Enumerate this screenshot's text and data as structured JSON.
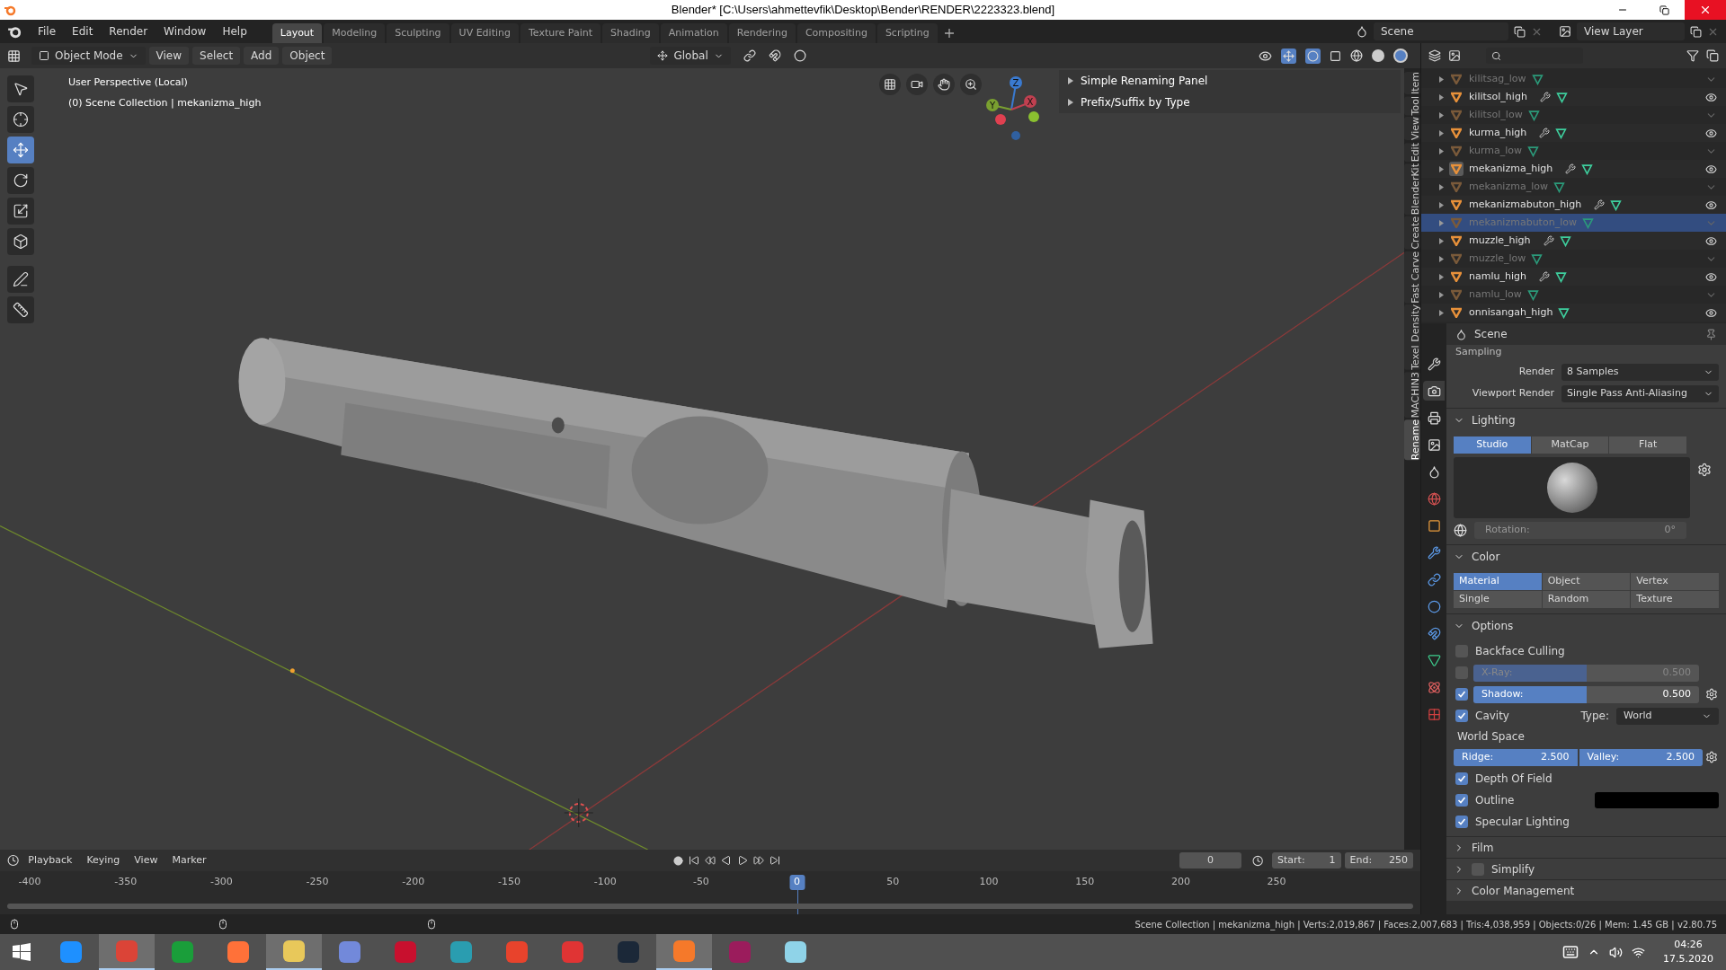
{
  "window": {
    "title": "Blender* [C:\\Users\\ahmettevfik\\Desktop\\Bender\\RENDER\\2223323.blend]"
  },
  "menu": [
    "File",
    "Edit",
    "Render",
    "Window",
    "Help"
  ],
  "workspaces": [
    {
      "label": "Layout",
      "selected": true
    },
    {
      "label": "Modeling",
      "selected": false
    },
    {
      "label": "Sculpting",
      "selected": false
    },
    {
      "label": "UV Editing",
      "selected": false
    },
    {
      "label": "Texture Paint",
      "selected": false
    },
    {
      "label": "Shading",
      "selected": false
    },
    {
      "label": "Animation",
      "selected": false
    },
    {
      "label": "Rendering",
      "selected": false
    },
    {
      "label": "Compositing",
      "selected": false
    },
    {
      "label": "Scripting",
      "selected": false
    }
  ],
  "scene_field": "Scene",
  "view_layer_field": "View Layer",
  "viewport_header": {
    "mode": "Object Mode",
    "menus": [
      "View",
      "Select",
      "Add",
      "Object"
    ],
    "orientation": "Global"
  },
  "toolbar": [
    {
      "kind": "select",
      "selected": false
    },
    {
      "kind": "cursor",
      "selected": false
    },
    {
      "kind": "move",
      "selected": true
    },
    {
      "kind": "rotate",
      "selected": false
    },
    {
      "kind": "scale",
      "selected": false
    },
    {
      "kind": "transform",
      "selected": false
    },
    {
      "kind": "annotate",
      "selected": false
    },
    {
      "kind": "measure",
      "selected": false
    }
  ],
  "viewport": {
    "info": [
      "User Perspective (Local)",
      "(0) Scene Collection | mekanizma_high"
    ],
    "gizmo": {
      "z": "Z",
      "y": "Y",
      "x": "X"
    },
    "panels": [
      "Simple Renaming Panel",
      "Prefix/Suffix by Type"
    ]
  },
  "side_tabs": [
    {
      "label": "Item",
      "selected": false
    },
    {
      "label": "Tool",
      "selected": false
    },
    {
      "label": "View",
      "selected": false
    },
    {
      "label": "Edit",
      "selected": false
    },
    {
      "label": "BlenderKit",
      "selected": false
    },
    {
      "label": "Create",
      "selected": false
    },
    {
      "label": "Fast Carve",
      "selected": false
    },
    {
      "label": "Texel Density",
      "selected": false
    },
    {
      "label": "MACHIN3",
      "selected": false
    },
    {
      "label": "Rename",
      "selected": true
    }
  ],
  "outliner": [
    {
      "name": "kilitsag_low",
      "visible": false,
      "modifiers": false,
      "selected": false,
      "active": false
    },
    {
      "name": "kilitsol_high",
      "visible": true,
      "modifiers": true,
      "selected": false,
      "active": false
    },
    {
      "name": "kilitsol_low",
      "visible": false,
      "modifiers": false,
      "selected": false,
      "active": false
    },
    {
      "name": "kurma_high",
      "visible": true,
      "modifiers": true,
      "selected": false,
      "active": false
    },
    {
      "name": "kurma_low",
      "visible": false,
      "modifiers": false,
      "selected": false,
      "active": false
    },
    {
      "name": "mekanizma_high",
      "visible": true,
      "modifiers": true,
      "selected": false,
      "active": true
    },
    {
      "name": "mekanizma_low",
      "visible": false,
      "modifiers": false,
      "selected": false,
      "active": false
    },
    {
      "name": "mekanizmabuton_high",
      "visible": true,
      "modifiers": true,
      "selected": false,
      "active": false
    },
    {
      "name": "mekanizmabuton_low",
      "visible": false,
      "modifiers": false,
      "selected": true,
      "active": false
    },
    {
      "name": "muzzle_high",
      "visible": true,
      "modifiers": true,
      "selected": false,
      "active": false
    },
    {
      "name": "muzzle_low",
      "visible": false,
      "modifiers": false,
      "selected": false,
      "active": false
    },
    {
      "name": "namlu_high",
      "visible": true,
      "modifiers": true,
      "selected": false,
      "active": false
    },
    {
      "name": "namlu_low",
      "visible": false,
      "modifiers": false,
      "selected": false,
      "active": false
    },
    {
      "name": "onnisangah_high",
      "visible": true,
      "modifiers": false,
      "selected": false,
      "active": false
    }
  ],
  "properties": {
    "context": "Scene",
    "tabs": [
      {
        "kind": "tool",
        "selected": false
      },
      {
        "kind": "render",
        "selected": true
      },
      {
        "kind": "output",
        "selected": false
      },
      {
        "kind": "view_layer",
        "selected": false
      },
      {
        "kind": "scene",
        "selected": false
      },
      {
        "kind": "world",
        "selected": false
      },
      {
        "kind": "object",
        "selected": false
      },
      {
        "kind": "modifiers",
        "selected": false
      },
      {
        "kind": "particles",
        "selected": false
      },
      {
        "kind": "physics",
        "selected": false
      },
      {
        "kind": "constraints",
        "selected": false
      },
      {
        "kind": "data",
        "selected": false
      },
      {
        "kind": "material",
        "selected": false
      },
      {
        "kind": "texture",
        "selected": false
      }
    ],
    "sampling": {
      "title": "Sampling",
      "rows": [
        {
          "label": "Render",
          "value": "8 Samples"
        },
        {
          "label": "Viewport Render",
          "value": "Single Pass Anti-Aliasing"
        }
      ]
    },
    "lighting": {
      "title": "Lighting",
      "expanded": true,
      "modes": [
        {
          "label": "Studio",
          "selected": true
        },
        {
          "label": "MatCap",
          "selected": false
        },
        {
          "label": "Flat",
          "selected": false
        }
      ],
      "rotation_label": "Rotation:",
      "rotation": "0°"
    },
    "color": {
      "title": "Color",
      "expanded": true,
      "options": [
        {
          "label": "Material",
          "selected": true
        },
        {
          "label": "Object",
          "selected": false
        },
        {
          "label": "Vertex",
          "selected": false
        },
        {
          "label": "Single",
          "selected": false
        },
        {
          "label": "Random",
          "selected": false
        },
        {
          "label": "Texture",
          "selected": false
        }
      ]
    },
    "options": {
      "title": "Options",
      "expanded": true,
      "items": [
        {
          "kind": "checkbox",
          "label": "Backface Culling",
          "checked": false
        },
        {
          "kind": "slider",
          "label": "X-Ray:",
          "value": "0.500",
          "level": 0.5,
          "checked": false
        },
        {
          "kind": "slider",
          "label": "Shadow:",
          "value": "0.500",
          "level": 0.5,
          "checked": true
        },
        {
          "kind": "cavity",
          "label": "Cavity",
          "checked": true,
          "type_label": "Type:",
          "type": "World"
        },
        {
          "kind": "label",
          "label": "World Space"
        },
        {
          "kind": "pair",
          "sliders": [
            {
              "label": "Ridge:",
              "value": "2.500",
              "level": 1
            },
            {
              "label": "Valley:",
              "value": "2.500",
              "level": 1
            }
          ]
        },
        {
          "kind": "checkbox",
          "label": "Depth Of Field",
          "checked": true
        },
        {
          "kind": "swatch",
          "label": "Outline",
          "checked": true,
          "color": "#000000"
        },
        {
          "kind": "checkbox",
          "label": "Specular Lighting",
          "checked": true
        }
      ]
    },
    "collapsed": [
      {
        "kind": "panel",
        "title": "Film"
      },
      {
        "kind": "checkbox_panel",
        "title": "Simplify",
        "checked": false
      },
      {
        "kind": "panel",
        "title": "Color Management"
      }
    ]
  },
  "timeline": {
    "menus": [
      "Playback",
      "Keying",
      "View",
      "Marker"
    ],
    "frame": "0",
    "start_label": "Start:",
    "start": "1",
    "end_label": "End:",
    "end": "250",
    "ticks": [
      {
        "label": "-400",
        "selected": false
      },
      {
        "label": "-350",
        "selected": false
      },
      {
        "label": "-300",
        "selected": false
      },
      {
        "label": "-250",
        "selected": false
      },
      {
        "label": "-200",
        "selected": false
      },
      {
        "label": "-150",
        "selected": false
      },
      {
        "label": "-100",
        "selected": false
      },
      {
        "label": "-50",
        "selected": false
      },
      {
        "label": "0",
        "selected": true
      },
      {
        "label": "50",
        "selected": false
      },
      {
        "label": "100",
        "selected": false
      },
      {
        "label": "150",
        "selected": false
      },
      {
        "label": "200",
        "selected": false
      },
      {
        "label": "250",
        "selected": false
      }
    ]
  },
  "status": "Scene Collection | mekanizma_high | Verts:2,019,867 | Faces:2,007,683 | Tris:4,038,959 | Objects:0/26 | Mem: 1.45 GB | v2.80.75",
  "taskbar": {
    "apps": [
      {
        "color": "#1e90ff",
        "active": false
      },
      {
        "color": "#db4437",
        "active": true
      },
      {
        "color": "#1a9e3a",
        "active": false
      },
      {
        "color": "#ff7139",
        "active": false
      },
      {
        "color": "#e8c85a",
        "active": true
      },
      {
        "color": "#7289da",
        "active": false
      },
      {
        "color": "#c8102e",
        "active": false
      },
      {
        "color": "#2a9db0",
        "active": false
      },
      {
        "color": "#e8432c",
        "active": false
      },
      {
        "color": "#e03434",
        "active": false
      },
      {
        "color": "#1b2838",
        "active": false
      },
      {
        "color": "#f5792a",
        "active": true
      },
      {
        "color": "#9b1c5c",
        "active": false
      },
      {
        "color": "#8fd3e8",
        "active": false
      }
    ],
    "time": "04:26",
    "date": "17.5.2020"
  }
}
